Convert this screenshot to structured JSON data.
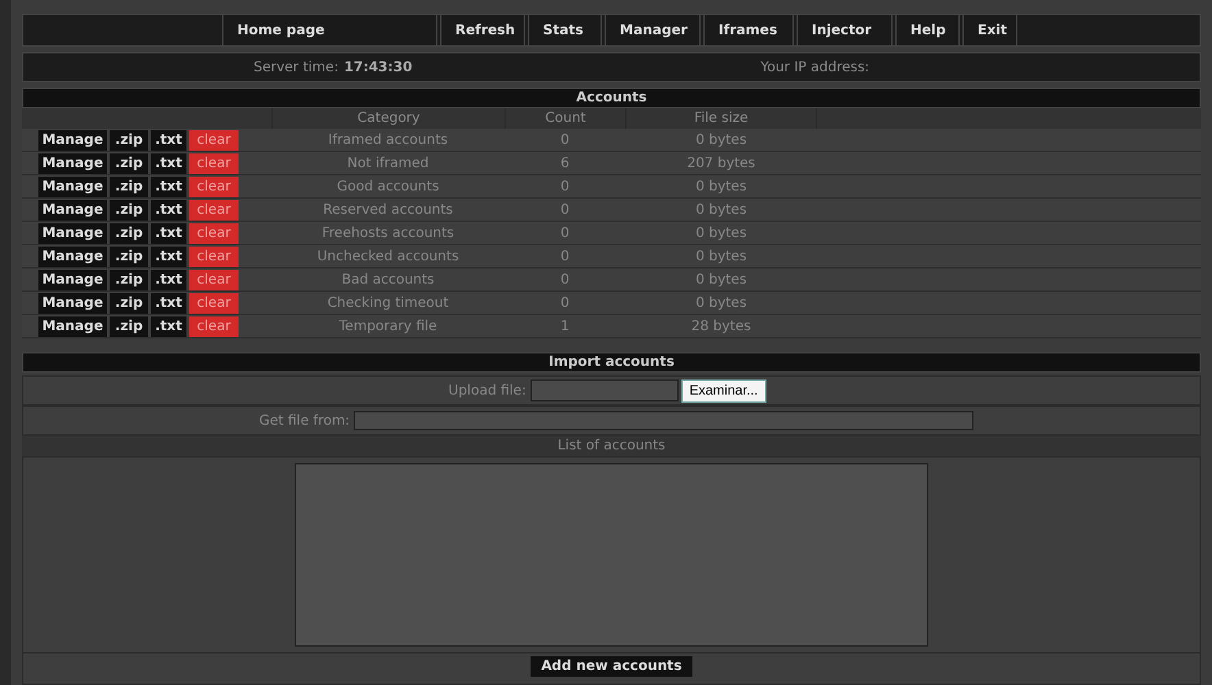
{
  "nav": [
    {
      "label": "Home page"
    },
    {
      "label": "Refresh"
    },
    {
      "label": "Stats"
    },
    {
      "label": "Manager"
    },
    {
      "label": "Iframes"
    },
    {
      "label": "Injector"
    },
    {
      "label": "Help"
    },
    {
      "label": "Exit"
    }
  ],
  "info": {
    "server_time_label": "Server time:",
    "server_time": "17:43:30",
    "ip_label": "Your IP address:"
  },
  "accounts": {
    "title": "Accounts",
    "columns": [
      "Category",
      "Count",
      "File size"
    ],
    "rows": [
      {
        "actions": [
          "Manage",
          ".zip",
          ".txt",
          "clear"
        ],
        "category": "Iframed accounts",
        "count": "0",
        "size": "0 bytes"
      },
      {
        "actions": [
          "Manage",
          ".zip",
          ".txt",
          "clear"
        ],
        "category": "Not iframed",
        "count": "6",
        "size": "207 bytes"
      },
      {
        "actions": [
          "Manage",
          ".zip",
          ".txt",
          "clear"
        ],
        "category": "Good accounts",
        "count": "0",
        "size": "0 bytes"
      },
      {
        "actions": [
          "Manage",
          ".zip",
          ".txt",
          "clear"
        ],
        "category": "Reserved accounts",
        "count": "0",
        "size": "0 bytes"
      },
      {
        "actions": [
          "Manage",
          ".zip",
          ".txt",
          "clear"
        ],
        "category": "Freehosts accounts",
        "count": "0",
        "size": "0 bytes"
      },
      {
        "actions": [
          "Manage",
          ".zip",
          ".txt",
          "clear"
        ],
        "category": "Unchecked accounts",
        "count": "0",
        "size": "0 bytes"
      },
      {
        "actions": [
          "Manage",
          ".zip",
          ".txt",
          "clear"
        ],
        "category": "Bad accounts",
        "count": "0",
        "size": "0 bytes"
      },
      {
        "actions": [
          "Manage",
          ".zip",
          ".txt",
          "clear"
        ],
        "category": "Checking timeout",
        "count": "0",
        "size": "0 bytes"
      },
      {
        "actions": [
          "Manage",
          ".zip",
          ".txt",
          "clear"
        ],
        "category": "Temporary file",
        "count": "1",
        "size": "28 bytes"
      }
    ]
  },
  "import": {
    "title": "Import accounts",
    "upload_label": "Upload file:",
    "browse_button": "Examinar...",
    "url_label": "Get file from:",
    "list_label": "List of accounts",
    "submit": "Add new accounts"
  }
}
